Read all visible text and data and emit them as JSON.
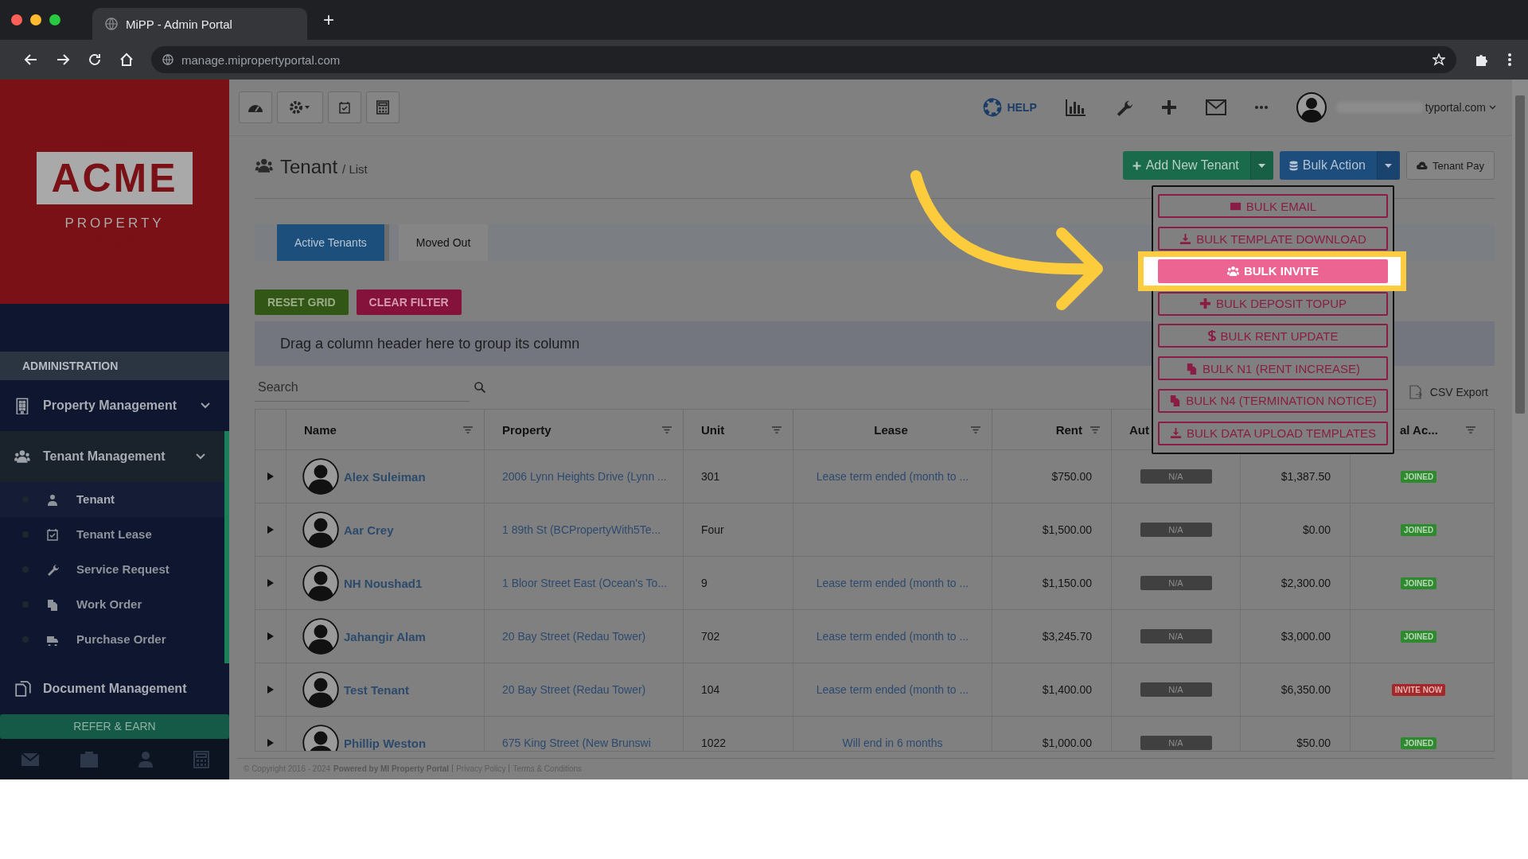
{
  "browser": {
    "tab_title": "MiPP - Admin Portal",
    "new_tab": "+",
    "url": "manage.mipropertyportal.com"
  },
  "sidebar": {
    "logo": {
      "name": "ACME",
      "tagline": "PROPERTY"
    },
    "section": "ADMINISTRATION",
    "items": [
      {
        "label": "Property Management",
        "expandable": true,
        "expanded": false
      },
      {
        "label": "Tenant Management",
        "expandable": true,
        "expanded": true,
        "children": [
          {
            "label": "Tenant",
            "selected": true
          },
          {
            "label": "Tenant Lease",
            "selected": false
          },
          {
            "label": "Service Request",
            "selected": false
          },
          {
            "label": "Work Order",
            "selected": false
          },
          {
            "label": "Purchase Order",
            "selected": false
          }
        ]
      },
      {
        "label": "Document Management",
        "expandable": false,
        "expanded": false
      }
    ],
    "refer": "REFER & EARN"
  },
  "topbar": {
    "help": "HELP",
    "account": "typortal.com"
  },
  "page": {
    "title": "Tenant",
    "crumb": "/ List",
    "actions": [
      {
        "label": "Add New Tenant",
        "kind": "add"
      },
      {
        "label": "Bulk Action",
        "kind": "bulk"
      },
      {
        "label": "Tenant Pay",
        "kind": "pay"
      }
    ]
  },
  "tabs": [
    {
      "label": "Active Tenants",
      "selected": true
    },
    {
      "label": "Moved Out",
      "selected": false
    }
  ],
  "grid_buttons": [
    {
      "label": "RESET GRID",
      "kind": "reset"
    },
    {
      "label": "CLEAR FILTER",
      "kind": "clear"
    }
  ],
  "group_hint": "Drag a column header here to group its column",
  "search": {
    "placeholder": "Search"
  },
  "csv_export": "CSV Export",
  "columns": [
    {
      "label": "Name"
    },
    {
      "label": "Property"
    },
    {
      "label": "Unit"
    },
    {
      "label": "Lease"
    },
    {
      "label": "Rent"
    },
    {
      "label": "Aut"
    },
    {},
    {
      "label": "al Ac..."
    }
  ],
  "rows": [
    {
      "name": "Alex Suleiman",
      "property": "2006 Lynn Heights Drive (Lynn ...",
      "unit": "301",
      "lease": "Lease term ended (month to ...",
      "rent": "$750.00",
      "column_6": "N/A",
      "column_7": "$1,387.50",
      "status": {
        "label": "JOINED",
        "kind": "joined"
      }
    },
    {
      "name": "Aar Crey",
      "property": "1 89th St (BCPropertyWith5Te...",
      "unit": "Four",
      "rent": "$1,500.00",
      "column_6": "N/A",
      "column_7": "$0.00",
      "status": {
        "label": "JOINED",
        "kind": "joined"
      }
    },
    {
      "name": "NH Noushad1",
      "property": "1 Bloor Street East (Ocean's To...",
      "unit": "9",
      "lease": "Lease term ended (month to ...",
      "rent": "$1,150.00",
      "column_6": "N/A",
      "column_7": "$2,300.00",
      "status": {
        "label": "JOINED",
        "kind": "joined"
      }
    },
    {
      "name": "Jahangir Alam",
      "property": "20 Bay Street (Redau Tower)",
      "unit": "702",
      "lease": "Lease term ended (month to ...",
      "rent": "$3,245.70",
      "column_6": "N/A",
      "column_7": "$3,000.00",
      "status": {
        "label": "JOINED",
        "kind": "joined"
      }
    },
    {
      "name": "Test Tenant",
      "property": "20 Bay Street (Redau Tower)",
      "unit": "104",
      "lease": "Lease term ended (month to ...",
      "rent": "$1,400.00",
      "column_6": "N/A",
      "column_7": "$6,350.00",
      "status": {
        "label": "INVITE NOW",
        "kind": "invite"
      }
    },
    {
      "name": "Phillip Weston",
      "property": "675 King Street (New Brunswi",
      "unit": "1022",
      "lease": "Will end in 6 months",
      "rent": "$1,000.00",
      "column_6": "N/A",
      "column_7": "$50.00",
      "status": {
        "label": "JOINED",
        "kind": "joined"
      }
    }
  ],
  "bulk_menu": [
    {
      "label": "BULK EMAIL",
      "selected": false
    },
    {
      "label": "BULK TEMPLATE DOWNLOAD",
      "selected": false
    },
    {
      "label": "BULK INVITE",
      "selected": true
    },
    {
      "label": "BULK DEPOSIT TOPUP",
      "selected": false
    },
    {
      "label": "BULK RENT UPDATE",
      "selected": false
    },
    {
      "label": "BULK N1 (RENT INCREASE)",
      "selected": false
    },
    {
      "label": "BULK N4 (TERMINATION NOTICE)",
      "selected": false
    },
    {
      "label": "BULK DATA UPLOAD TEMPLATES",
      "selected": false
    }
  ],
  "footer": {
    "copyright": "© Copyright 2016 - 2024",
    "powered": "Powered by MI Property Portal",
    "links": [
      "Privacy Policy",
      "Terms & Conditions"
    ]
  }
}
